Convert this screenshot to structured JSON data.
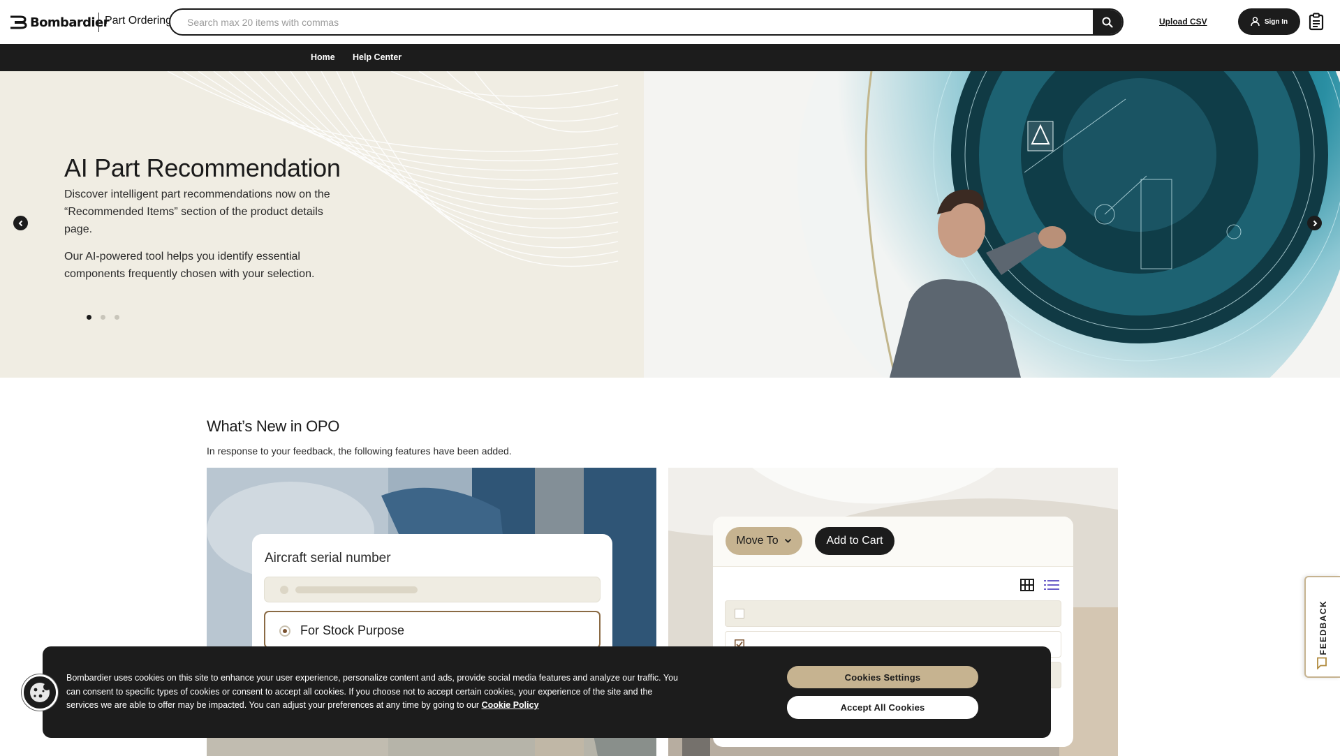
{
  "header": {
    "brand": "Bombardier",
    "brand_sub": "Part Ordering",
    "search_placeholder": "Search max 20 items with commas",
    "upload_csv": "Upload CSV",
    "sign_in": "Sign In",
    "icons": {
      "search": "search-icon",
      "user": "user-icon",
      "orders": "clipboard-icon"
    }
  },
  "nav": {
    "items": [
      "Home",
      "Help Center"
    ]
  },
  "hero": {
    "title": "AI Part Recommendation",
    "paragraph1": "Discover intelligent part recommendations now on the “Recommended Items” section of the product details page.",
    "paragraph2": "Our AI-powered tool helps you identify essential components frequently chosen with your selection.",
    "slides_count": 3,
    "active_slide": 1
  },
  "whats_new": {
    "title": "What’s New in OPO",
    "subtitle": "In response to your feedback, the following features have been added.",
    "card1": {
      "panel_title": "Aircraft serial number",
      "option_label": "For Stock Purpose"
    },
    "card2": {
      "move_to": "Move To",
      "add_to_cart": "Add to Cart"
    }
  },
  "cookie": {
    "text": "Bombardier uses cookies on this site to enhance your user experience, personalize content and ads, provide social media features and analyze our traffic. You can consent to specific types of cookies or consent to accept all cookies. If you choose not to accept certain cookies, your experience of the site and the services we are able to offer may be impacted. You can adjust your preferences at any time by going to our",
    "policy_link": "Cookie Policy",
    "settings_button": "Cookies Settings",
    "accept_button": "Accept All Cookies"
  },
  "feedback": {
    "label": "FEEDBACK"
  },
  "colors": {
    "dark": "#1c1c1c",
    "hero_bg": "#f0ede3",
    "accent_tan": "#c6b390",
    "feedback_border": "#c6b390"
  }
}
